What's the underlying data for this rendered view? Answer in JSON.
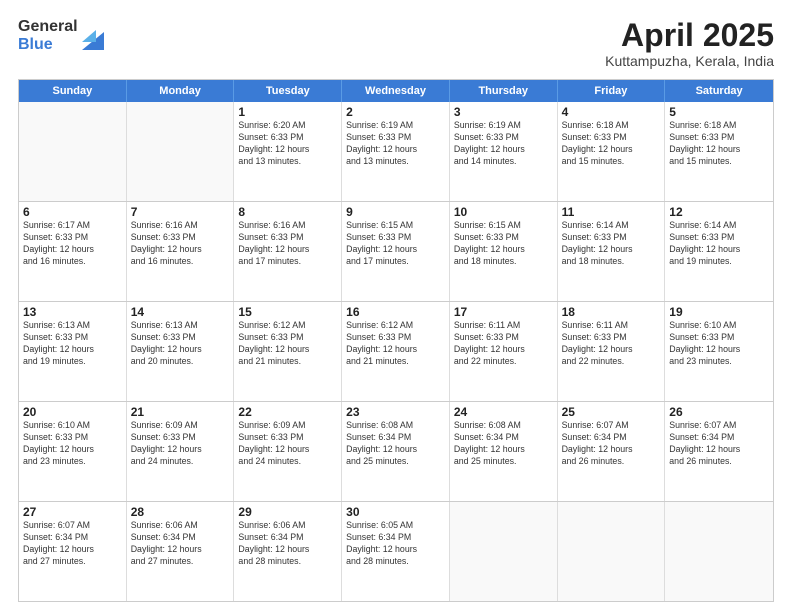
{
  "header": {
    "logo": {
      "general": "General",
      "blue": "Blue"
    },
    "title": "April 2025",
    "subtitle": "Kuttampuzha, Kerala, India"
  },
  "calendar": {
    "weekdays": [
      "Sunday",
      "Monday",
      "Tuesday",
      "Wednesday",
      "Thursday",
      "Friday",
      "Saturday"
    ],
    "rows": [
      [
        {
          "day": "",
          "info": ""
        },
        {
          "day": "",
          "info": ""
        },
        {
          "day": "1",
          "info": "Sunrise: 6:20 AM\nSunset: 6:33 PM\nDaylight: 12 hours\nand 13 minutes."
        },
        {
          "day": "2",
          "info": "Sunrise: 6:19 AM\nSunset: 6:33 PM\nDaylight: 12 hours\nand 13 minutes."
        },
        {
          "day": "3",
          "info": "Sunrise: 6:19 AM\nSunset: 6:33 PM\nDaylight: 12 hours\nand 14 minutes."
        },
        {
          "day": "4",
          "info": "Sunrise: 6:18 AM\nSunset: 6:33 PM\nDaylight: 12 hours\nand 15 minutes."
        },
        {
          "day": "5",
          "info": "Sunrise: 6:18 AM\nSunset: 6:33 PM\nDaylight: 12 hours\nand 15 minutes."
        }
      ],
      [
        {
          "day": "6",
          "info": "Sunrise: 6:17 AM\nSunset: 6:33 PM\nDaylight: 12 hours\nand 16 minutes."
        },
        {
          "day": "7",
          "info": "Sunrise: 6:16 AM\nSunset: 6:33 PM\nDaylight: 12 hours\nand 16 minutes."
        },
        {
          "day": "8",
          "info": "Sunrise: 6:16 AM\nSunset: 6:33 PM\nDaylight: 12 hours\nand 17 minutes."
        },
        {
          "day": "9",
          "info": "Sunrise: 6:15 AM\nSunset: 6:33 PM\nDaylight: 12 hours\nand 17 minutes."
        },
        {
          "day": "10",
          "info": "Sunrise: 6:15 AM\nSunset: 6:33 PM\nDaylight: 12 hours\nand 18 minutes."
        },
        {
          "day": "11",
          "info": "Sunrise: 6:14 AM\nSunset: 6:33 PM\nDaylight: 12 hours\nand 18 minutes."
        },
        {
          "day": "12",
          "info": "Sunrise: 6:14 AM\nSunset: 6:33 PM\nDaylight: 12 hours\nand 19 minutes."
        }
      ],
      [
        {
          "day": "13",
          "info": "Sunrise: 6:13 AM\nSunset: 6:33 PM\nDaylight: 12 hours\nand 19 minutes."
        },
        {
          "day": "14",
          "info": "Sunrise: 6:13 AM\nSunset: 6:33 PM\nDaylight: 12 hours\nand 20 minutes."
        },
        {
          "day": "15",
          "info": "Sunrise: 6:12 AM\nSunset: 6:33 PM\nDaylight: 12 hours\nand 21 minutes."
        },
        {
          "day": "16",
          "info": "Sunrise: 6:12 AM\nSunset: 6:33 PM\nDaylight: 12 hours\nand 21 minutes."
        },
        {
          "day": "17",
          "info": "Sunrise: 6:11 AM\nSunset: 6:33 PM\nDaylight: 12 hours\nand 22 minutes."
        },
        {
          "day": "18",
          "info": "Sunrise: 6:11 AM\nSunset: 6:33 PM\nDaylight: 12 hours\nand 22 minutes."
        },
        {
          "day": "19",
          "info": "Sunrise: 6:10 AM\nSunset: 6:33 PM\nDaylight: 12 hours\nand 23 minutes."
        }
      ],
      [
        {
          "day": "20",
          "info": "Sunrise: 6:10 AM\nSunset: 6:33 PM\nDaylight: 12 hours\nand 23 minutes."
        },
        {
          "day": "21",
          "info": "Sunrise: 6:09 AM\nSunset: 6:33 PM\nDaylight: 12 hours\nand 24 minutes."
        },
        {
          "day": "22",
          "info": "Sunrise: 6:09 AM\nSunset: 6:33 PM\nDaylight: 12 hours\nand 24 minutes."
        },
        {
          "day": "23",
          "info": "Sunrise: 6:08 AM\nSunset: 6:34 PM\nDaylight: 12 hours\nand 25 minutes."
        },
        {
          "day": "24",
          "info": "Sunrise: 6:08 AM\nSunset: 6:34 PM\nDaylight: 12 hours\nand 25 minutes."
        },
        {
          "day": "25",
          "info": "Sunrise: 6:07 AM\nSunset: 6:34 PM\nDaylight: 12 hours\nand 26 minutes."
        },
        {
          "day": "26",
          "info": "Sunrise: 6:07 AM\nSunset: 6:34 PM\nDaylight: 12 hours\nand 26 minutes."
        }
      ],
      [
        {
          "day": "27",
          "info": "Sunrise: 6:07 AM\nSunset: 6:34 PM\nDaylight: 12 hours\nand 27 minutes."
        },
        {
          "day": "28",
          "info": "Sunrise: 6:06 AM\nSunset: 6:34 PM\nDaylight: 12 hours\nand 27 minutes."
        },
        {
          "day": "29",
          "info": "Sunrise: 6:06 AM\nSunset: 6:34 PM\nDaylight: 12 hours\nand 28 minutes."
        },
        {
          "day": "30",
          "info": "Sunrise: 6:05 AM\nSunset: 6:34 PM\nDaylight: 12 hours\nand 28 minutes."
        },
        {
          "day": "",
          "info": ""
        },
        {
          "day": "",
          "info": ""
        },
        {
          "day": "",
          "info": ""
        }
      ]
    ]
  }
}
